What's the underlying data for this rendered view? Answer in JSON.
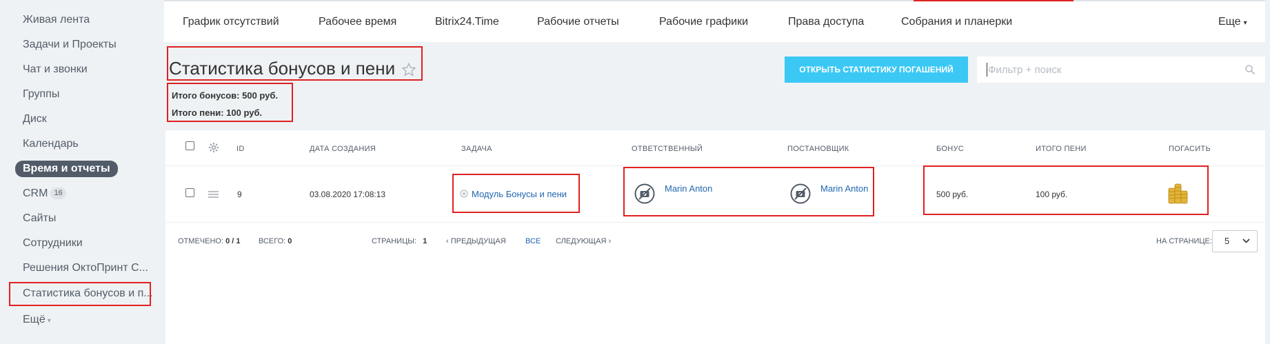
{
  "sidebar": {
    "items": [
      {
        "label": "Живая лента"
      },
      {
        "label": "Задачи и Проекты"
      },
      {
        "label": "Чат и звонки"
      },
      {
        "label": "Группы"
      },
      {
        "label": "Диск"
      },
      {
        "label": "Календарь"
      },
      {
        "label": "Время и отчеты"
      },
      {
        "label": "CRM",
        "count": "16"
      },
      {
        "label": "Сайты"
      },
      {
        "label": "Сотрудники"
      },
      {
        "label": "Решения ОктоПринт С..."
      },
      {
        "label": "Статистика бонусов и п..."
      },
      {
        "label": "Ещё"
      }
    ]
  },
  "topnav": {
    "tabs": [
      "График отсутствий",
      "Рабочее время",
      "Bitrix24.Time",
      "Рабочие отчеты",
      "Рабочие графики",
      "Права доступа",
      "Собрания и планерки"
    ],
    "more": "Еще"
  },
  "page": {
    "title": "Статистика бонусов и пени",
    "total_bonus": "Итого бонусов: 500 руб.",
    "total_penalty": "Итого пени: 100 руб."
  },
  "toolbar": {
    "open_button": "ОТКРЫТЬ СТАТИСТИКУ ПОГАШЕНИЙ",
    "search_placeholder": "Фильтр + поиск"
  },
  "table": {
    "columns": [
      "ID",
      "ДАТА СОЗДАНИЯ",
      "ЗАДАЧА",
      "ОТВЕТСТВЕННЫЙ",
      "ПОСТАНОВЩИК",
      "БОНУС",
      "ИТОГО ПЕНИ",
      "ПОГАСИТЬ"
    ],
    "rows": [
      {
        "id": "9",
        "created": "03.08.2020 17:08:13",
        "task": "Модуль Бонусы и пени",
        "responsible": "Marin Anton",
        "creator": "Marin Anton",
        "bonus": "500 руб.",
        "penalty": "100 руб."
      }
    ]
  },
  "footer": {
    "selected_label": "ОТМЕЧЕНО:",
    "selected_value": "0 / 1",
    "total_label": "ВСЕГО:",
    "total_value": "0",
    "pages_label": "СТРАНИЦЫ:",
    "pages_value": "1",
    "prev": "ПРЕДЫДУЩАЯ",
    "all": "ВСЕ",
    "next": "СЛЕДУЮЩАЯ",
    "per_page_label": "НА СТРАНИЦЕ:",
    "per_page_value": "5"
  },
  "colors": {
    "accent": "#3bc8f5",
    "link": "#2067b0",
    "highlight": "#e02020",
    "active_sidebar": "#525c69"
  }
}
